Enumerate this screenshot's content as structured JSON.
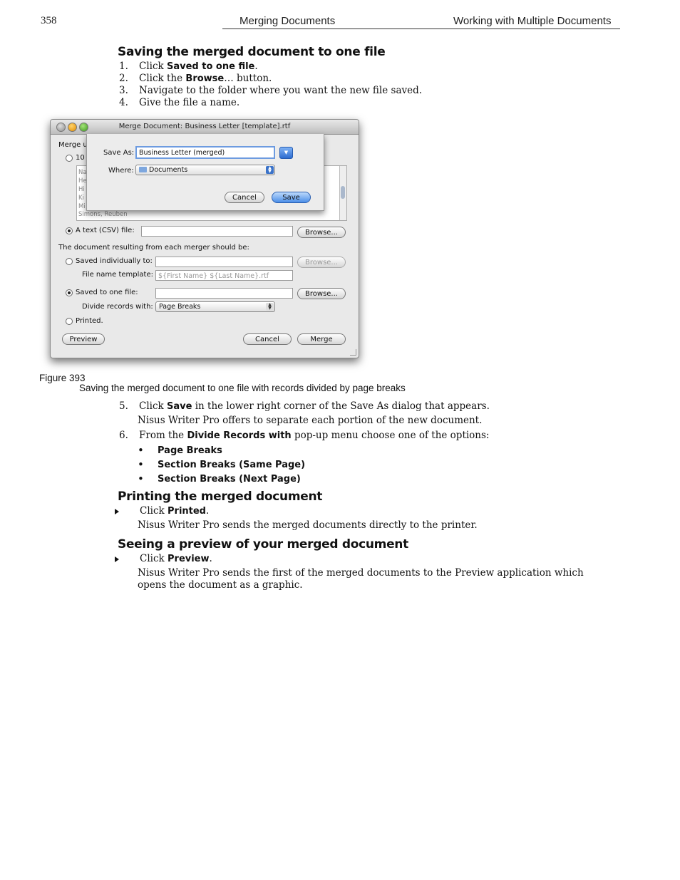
{
  "header": {
    "page_number": "358",
    "section": "Merging Documents",
    "chapter": "Working with Multiple Documents"
  },
  "section1": {
    "heading": "Saving the merged document to one file",
    "steps": [
      {
        "num": "1.",
        "pre": "Click ",
        "bold": "Saved to one file",
        "post": "."
      },
      {
        "num": "2.",
        "pre": "Click the ",
        "bold": "Browse",
        "post": "… button."
      },
      {
        "num": "3.",
        "pre": "Navigate to the folder where you want the new file saved.",
        "bold": "",
        "post": ""
      },
      {
        "num": "4.",
        "pre": "Give the file a name.",
        "bold": "",
        "post": ""
      }
    ]
  },
  "screenshot": {
    "window_title": "Merge Document: Business Letter [template].rtf",
    "sheet": {
      "save_as_label": "Save As:",
      "save_as_value": "Business Letter (merged)",
      "where_label": "Where:",
      "where_value": "Documents",
      "cancel": "Cancel",
      "save": "Save"
    },
    "merge_using_label": "Merge u",
    "radio_10": "10",
    "list_rows": [
      "Na",
      "He",
      "Hi",
      "Ki",
      "Mi",
      "Simons, Reuben"
    ],
    "csv_label": "A text (CSV) file:",
    "browse": "Browse...",
    "result_label": "The document resulting from each merger should be:",
    "saved_individually": "Saved individually to:",
    "file_name_template_label": "File name template:",
    "file_name_template_value": "${First Name} ${Last Name}.rtf",
    "saved_to_one_file": "Saved to one file:",
    "divide_records_label": "Divide records with:",
    "divide_records_value": "Page Breaks",
    "printed": "Printed.",
    "preview": "Preview",
    "cancel": "Cancel",
    "merge": "Merge"
  },
  "figure": {
    "label": "Figure 393",
    "caption": "Saving the merged document to one file with records divided by page breaks"
  },
  "section1_cont": {
    "step5": {
      "num": "5.",
      "pre": "Click ",
      "bold": "Save",
      "post": " in the lower right corner of the Save As dialog that appears."
    },
    "step5_note": "Nisus Writer Pro offers to separate each portion of the new document.",
    "step6": {
      "num": "6.",
      "pre": "From the ",
      "bold": "Divide Records with",
      "post": " pop-up menu choose one of the options:"
    },
    "options": [
      "Page Breaks",
      "Section Breaks (Same Page)",
      "Section Breaks (Next Page)"
    ]
  },
  "section2": {
    "heading": "Printing the merged document",
    "step": {
      "pre": "Click ",
      "bold": "Printed",
      "post": "."
    },
    "note": "Nisus Writer Pro sends the merged documents directly to the printer."
  },
  "section3": {
    "heading": "Seeing a preview of your merged document",
    "step": {
      "pre": "Click ",
      "bold": "Preview",
      "post": "."
    },
    "note_line1": "Nisus Writer Pro sends the first of the merged documents to the Preview application which",
    "note_line2": "opens the document as a graphic."
  }
}
